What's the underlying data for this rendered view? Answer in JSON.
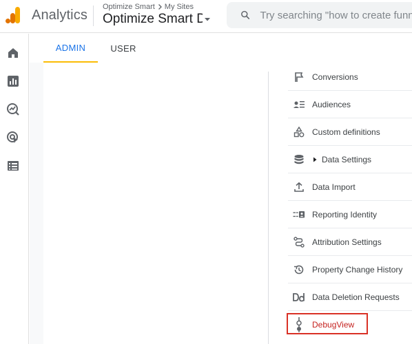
{
  "header": {
    "app_name": "Analytics",
    "breadcrumb": [
      "Optimize Smart",
      "My Sites"
    ],
    "property_name": "Optimize Smart D",
    "search_placeholder": "Try searching \"how to create funne"
  },
  "rail": {
    "icons": [
      "home-icon",
      "reports-icon",
      "explore-icon",
      "advertising-icon",
      "configure-icon"
    ]
  },
  "tabs": [
    {
      "label": "ADMIN",
      "active": true
    },
    {
      "label": "USER",
      "active": false
    }
  ],
  "property_menu": [
    {
      "label": "Conversions",
      "icon": "flag-icon"
    },
    {
      "label": "Audiences",
      "icon": "audiences-icon"
    },
    {
      "label": "Custom definitions",
      "icon": "shapes-icon"
    },
    {
      "label": "Data Settings",
      "icon": "database-icon",
      "expandable": true
    },
    {
      "label": "Data Import",
      "icon": "upload-icon"
    },
    {
      "label": "Reporting Identity",
      "icon": "identity-icon"
    },
    {
      "label": "Attribution Settings",
      "icon": "attribution-icon"
    },
    {
      "label": "Property Change History",
      "icon": "history-icon"
    },
    {
      "label": "Data Deletion Requests",
      "icon": "dd-icon"
    },
    {
      "label": "DebugView",
      "icon": "debug-icon",
      "highlighted": true
    }
  ],
  "colors": {
    "accent": "#1a73e8",
    "tab_underline": "#fbbc04",
    "highlight_border": "#d93025",
    "logo_orange": "#f9ab00",
    "logo_dark_orange": "#e37400"
  }
}
